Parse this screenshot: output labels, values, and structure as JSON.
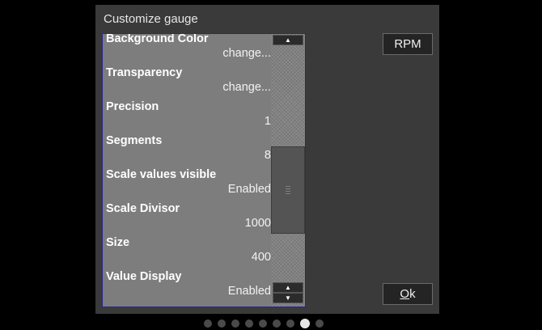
{
  "dialog": {
    "title": "Customize gauge",
    "settings": [
      {
        "label": "Background Color",
        "value": "change..."
      },
      {
        "label": "Transparency",
        "value": "change..."
      },
      {
        "label": "Precision",
        "value": "1"
      },
      {
        "label": "Segments",
        "value": "8"
      },
      {
        "label": "Scale values visible",
        "value": "Enabled"
      },
      {
        "label": "Scale Divisor",
        "value": "1000"
      },
      {
        "label": "Size",
        "value": "400"
      },
      {
        "label": "Value Display",
        "value": "Enabled"
      }
    ],
    "rpm_button": "RPM",
    "ok_button": {
      "mnemonic": "O",
      "rest": "k"
    }
  },
  "scrollbar": {
    "up_arrow": "▲",
    "down_arrow": "▼",
    "position_fraction": 0.45
  },
  "pager": {
    "page_count": 9,
    "active_index": 7
  },
  "colors": {
    "list_background": "#7d7d7d",
    "list_border": "#26268c",
    "dialog_background": "#3a3a3a"
  }
}
